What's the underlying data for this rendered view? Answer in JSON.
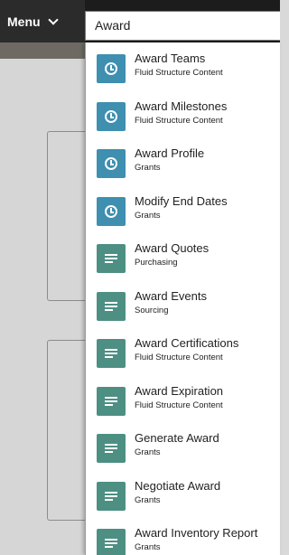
{
  "header": {
    "menu_label": "Menu",
    "search_value": "Award"
  },
  "results": [
    {
      "title": "Award Teams",
      "subtitle": "Fluid Structure Content",
      "icon": "clock-icon"
    },
    {
      "title": "Award Milestones",
      "subtitle": "Fluid Structure Content",
      "icon": "clock-icon"
    },
    {
      "title": "Award Profile",
      "subtitle": "Grants",
      "icon": "clock-icon"
    },
    {
      "title": "Modify End Dates",
      "subtitle": "Grants",
      "icon": "clock-icon"
    },
    {
      "title": "Award Quotes",
      "subtitle": "Purchasing",
      "icon": "document-icon"
    },
    {
      "title": "Award Events",
      "subtitle": "Sourcing",
      "icon": "document-icon"
    },
    {
      "title": "Award Certifications",
      "subtitle": "Fluid Structure Content",
      "icon": "document-icon"
    },
    {
      "title": "Award Expiration",
      "subtitle": "Fluid Structure Content",
      "icon": "document-icon"
    },
    {
      "title": "Generate Award",
      "subtitle": "Grants",
      "icon": "document-icon"
    },
    {
      "title": "Negotiate Award",
      "subtitle": "Grants",
      "icon": "document-icon"
    },
    {
      "title": "Award Inventory Report",
      "subtitle": "Grants",
      "icon": "document-icon"
    }
  ],
  "colors": {
    "clock_icon_bg": "#3e8fb0",
    "document_icon_bg": "#4d8f83"
  }
}
